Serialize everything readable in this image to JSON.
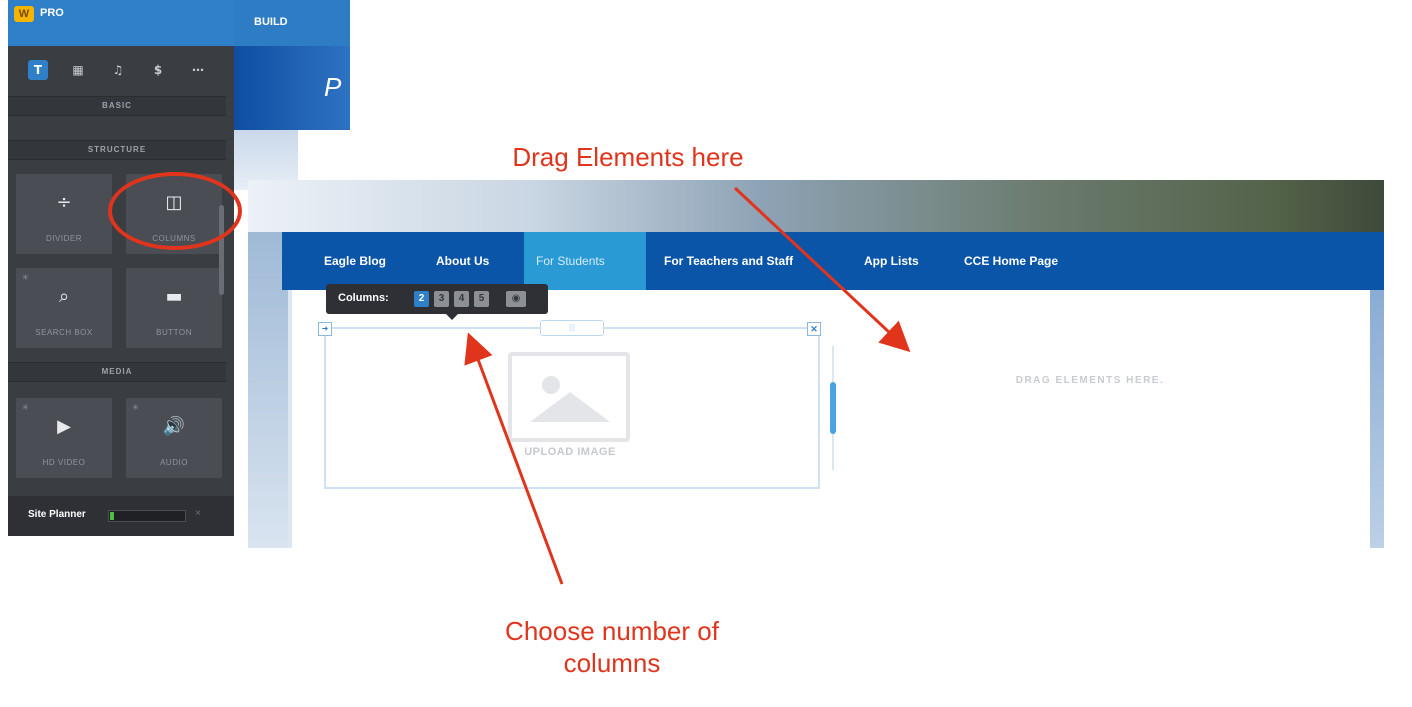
{
  "editor": {
    "brand": "PRO",
    "logo_letter": "W",
    "toolbar_icons": [
      {
        "name": "text-icon",
        "glyph": "T",
        "active": true
      },
      {
        "name": "layout-icon",
        "glyph": "▦",
        "active": false
      },
      {
        "name": "music-icon",
        "glyph": "♫",
        "active": false
      },
      {
        "name": "dollar-icon",
        "glyph": "$",
        "active": false
      },
      {
        "name": "more-icon",
        "glyph": "⋯",
        "active": false
      }
    ],
    "sections": {
      "basic": "BASIC",
      "structure": "STRUCTURE",
      "media": "MEDIA"
    },
    "tiles": {
      "divider": {
        "label": "DIVIDER",
        "icon": "÷"
      },
      "columns": {
        "label": "COLUMNS",
        "icon": "◫"
      },
      "search_box": {
        "label": "SEARCH BOX",
        "icon": "⌕"
      },
      "button": {
        "label": "BUTTON",
        "icon": "▬"
      },
      "hd_video": {
        "label": "HD VIDEO",
        "icon": "▶"
      },
      "audio": {
        "label": "AUDIO",
        "icon": "🔊"
      }
    },
    "site_planner": {
      "label": "Site Planner",
      "progress": 0.06,
      "close": "×"
    }
  },
  "build_tab": "BUILD",
  "site_title_fragment": "P",
  "site": {
    "nav": [
      {
        "label": "Eagle Blog",
        "active": false
      },
      {
        "label": "About Us",
        "active": false
      },
      {
        "label": "For Students",
        "active": true
      },
      {
        "label": "For Teachers and Staff",
        "active": false
      },
      {
        "label": "App Lists",
        "active": false
      },
      {
        "label": "CCE Home Page",
        "active": false
      }
    ],
    "columns_popup": {
      "label": "Columns:",
      "options": [
        "2",
        "3",
        "4",
        "5"
      ],
      "selected": "2"
    },
    "upload_image": "UPLOAD IMAGE",
    "drag_elements": "DRAG ELEMENTS HERE."
  },
  "annotations": {
    "drag_here": "Drag Elements here",
    "choose_columns_line1": "Choose number of",
    "choose_columns_line2": "columns",
    "color": "#e0341c"
  }
}
